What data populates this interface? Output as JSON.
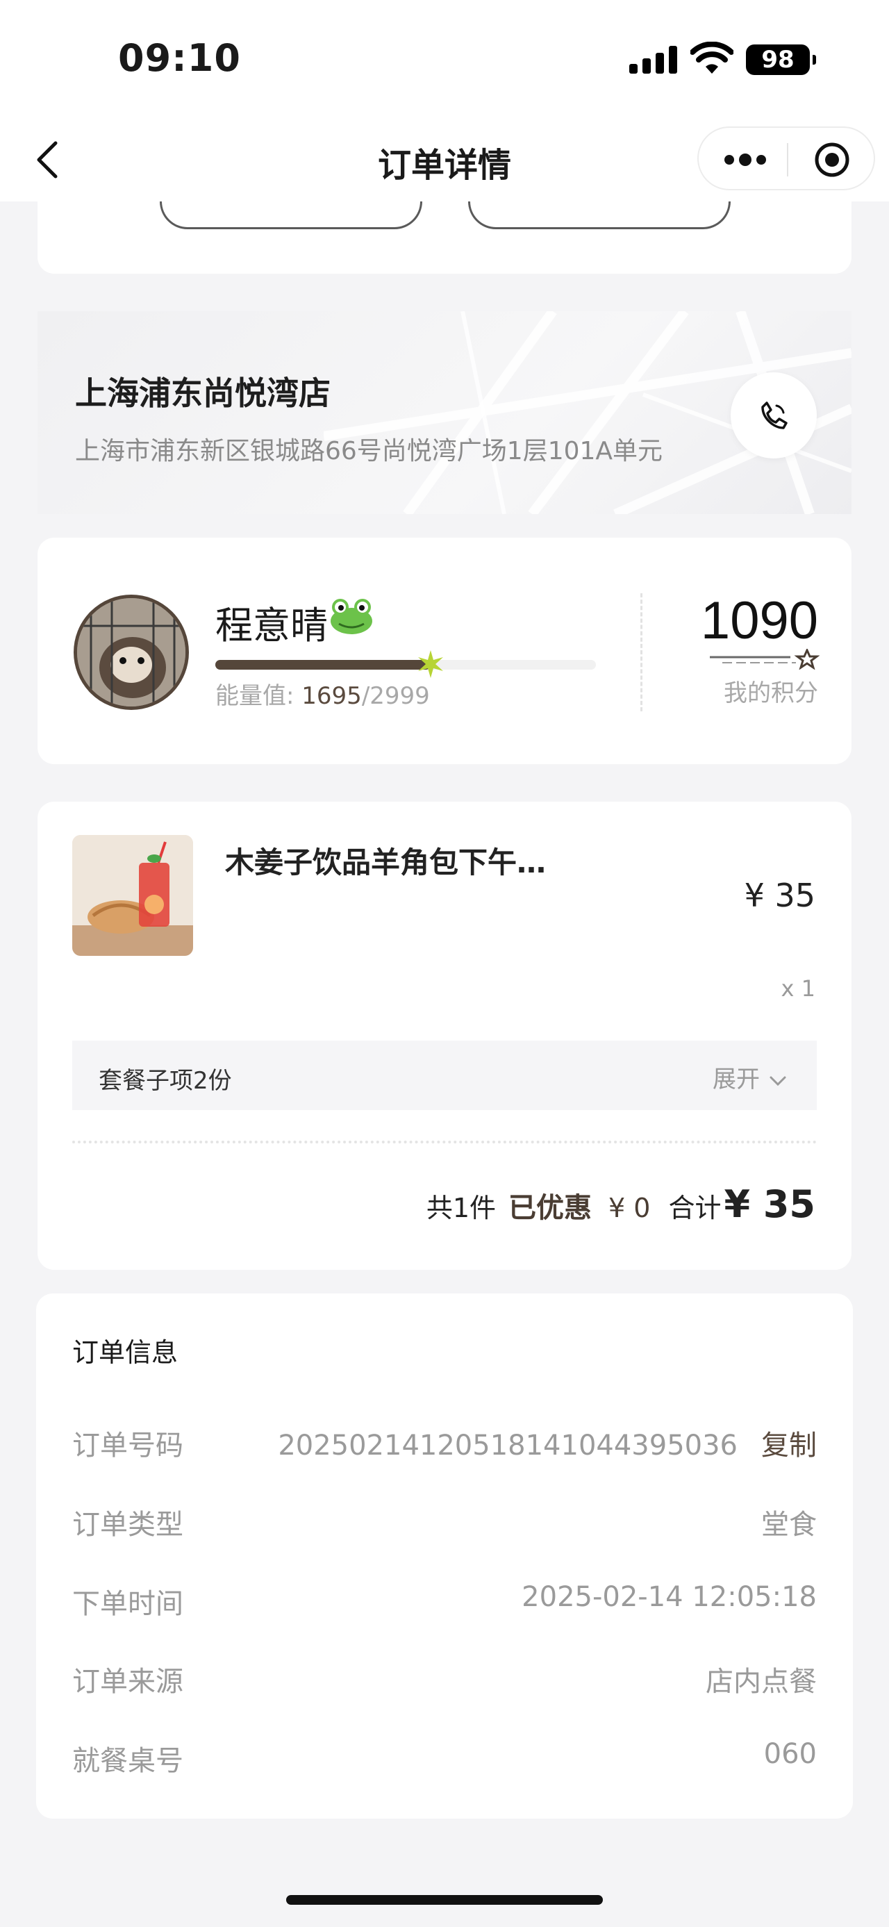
{
  "status": {
    "time": "09:10",
    "battery": "98"
  },
  "nav": {
    "title": "订单详情"
  },
  "store": {
    "name": "上海浦东尚悦湾店",
    "address": "上海市浦东新区银城路66号尚悦湾广场1层101A单元"
  },
  "member": {
    "nickname": "程意晴",
    "energy_label": "能量值:",
    "energy_current": "1695",
    "energy_total": "/2999",
    "energy_progress": 0.565,
    "points": "1090",
    "points_label": "我的积分"
  },
  "order": {
    "product_name": "木姜子饮品羊角包下午…",
    "price": "¥ 35",
    "quantity": "x 1",
    "combo_label": "套餐子项2份",
    "combo_toggle": "展开",
    "count_text": "共1件",
    "discount_label": "已优惠",
    "discount_amount": "¥ 0",
    "total_label": "合计",
    "total": "¥ 35"
  },
  "info": {
    "title": "订单信息",
    "order_no_label": "订单号码",
    "order_no": "2025021412051814104439503 6",
    "copy_label": "复制",
    "type_label": "订单类型",
    "type": "堂食",
    "time_label": "下单时间",
    "time": "2025-02-14 12:05:18",
    "source_label": "订单来源",
    "source": "店内点餐",
    "table_label": "就餐桌号",
    "table": "060"
  },
  "colors": {
    "brand_brown": "#55463a",
    "background": "#f4f4f6"
  }
}
